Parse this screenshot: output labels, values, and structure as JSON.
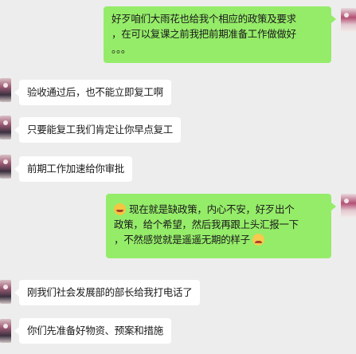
{
  "messages": [
    {
      "side": "right",
      "lines": [
        "好歹咱们大雨花也给我个相应的政策及要求",
        "，在可以复课之前我把前期准备工作做做好",
        "。。。"
      ]
    },
    {
      "side": "left",
      "text": "验收通过后，也不能立即复工啊"
    },
    {
      "side": "left",
      "text": "只要能复工我们肯定让你早点复工"
    },
    {
      "side": "left",
      "text": "前期工作加速给你审批"
    },
    {
      "side": "right",
      "emoji_start": "grimace-emoji",
      "emoji_end": "crying-emoji",
      "lines": [
        "现在就是缺政策，内心不安，好歹出个",
        "政策，给个希望，然后我再跟上头汇报一下",
        "，不然感觉就是遥遥无期的样子"
      ]
    },
    {
      "side": "left",
      "text": "刚我们社会发展部的部长给我打电话了"
    },
    {
      "side": "left",
      "text": "你们先准备好物资、预案和措施"
    }
  ]
}
